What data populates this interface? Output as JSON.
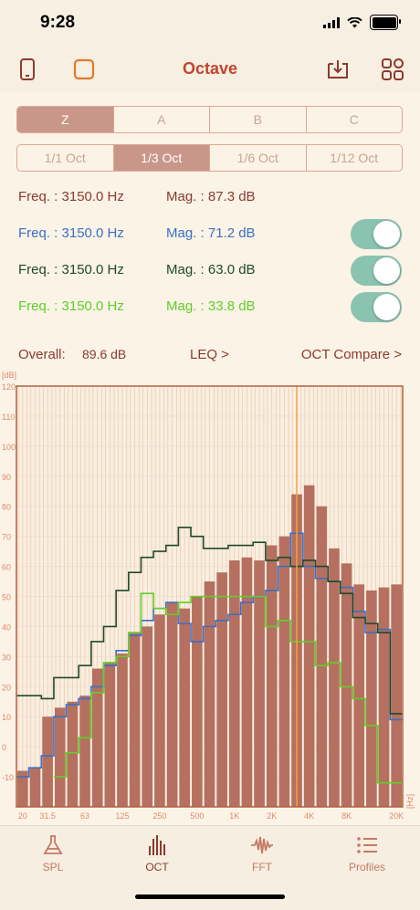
{
  "status": {
    "time": "9:28"
  },
  "nav": {
    "title": "Octave"
  },
  "weighting": {
    "options": [
      "Z",
      "A",
      "B",
      "C"
    ],
    "selected": 0
  },
  "bands": {
    "options": [
      "1/1 Oct",
      "1/3 Oct",
      "1/6 Oct",
      "1/12 Oct"
    ],
    "selected": 1
  },
  "readouts": [
    {
      "freq": "Freq. : 3150.0 Hz",
      "mag": "Mag. : 87.3 dB",
      "color": "#8b3a2f",
      "toggle": false
    },
    {
      "freq": "Freq. : 3150.0 Hz",
      "mag": "Mag. : 71.2 dB",
      "color": "#3d6fc4",
      "toggle": true
    },
    {
      "freq": "Freq. : 3150.0 Hz",
      "mag": "Mag. : 63.0 dB",
      "color": "#1f4a2a",
      "toggle": true
    },
    {
      "freq": "Freq. : 3150.0 Hz",
      "mag": "Mag. : 33.8 dB",
      "color": "#5fcf2a",
      "toggle": true
    }
  ],
  "overall": {
    "label": "Overall:",
    "value": "89.6 dB",
    "leq": "LEQ >",
    "compare": "OCT Compare >"
  },
  "chart_data": {
    "type": "bar",
    "ylabel": "[dB]",
    "xunit": "[Hz]",
    "ylim": [
      -20,
      120
    ],
    "yticks": [
      120,
      110,
      100,
      90,
      80,
      70,
      60,
      50,
      40,
      30,
      20,
      10,
      0,
      -10
    ],
    "xtick_labels": [
      "20",
      "31.5",
      "63",
      "125",
      "250",
      "500",
      "1K",
      "2K",
      "4K",
      "8K",
      "20K"
    ],
    "xtick_band_index": [
      0,
      2,
      5,
      8,
      11,
      14,
      17,
      20,
      23,
      26,
      30
    ],
    "bands_hz": [
      "20",
      "25",
      "31.5",
      "40",
      "50",
      "63",
      "80",
      "100",
      "125",
      "160",
      "200",
      "250",
      "315",
      "400",
      "500",
      "630",
      "800",
      "1K",
      "1.25K",
      "1.6K",
      "2K",
      "2.5K",
      "3.15K",
      "4K",
      "5K",
      "6.3K",
      "8K",
      "10K",
      "12.5K",
      "16K",
      "20K"
    ],
    "cursor_band_index": 22,
    "series": [
      {
        "values": [
          -8,
          -7,
          10,
          13,
          15,
          17,
          26,
          28,
          31,
          38,
          40,
          44,
          48,
          46,
          50,
          55,
          58,
          62,
          63,
          62,
          67,
          70,
          84,
          87,
          80,
          66,
          61,
          54,
          52,
          53,
          54
        ],
        "color": "#b5705f"
      },
      {
        "values": [
          -10,
          -7,
          -3,
          10,
          14,
          16,
          20,
          27,
          32,
          37,
          42,
          46,
          48,
          41,
          35,
          40,
          42,
          44,
          48,
          50,
          52,
          60,
          71,
          60,
          56,
          55,
          53,
          45,
          38,
          39,
          9
        ],
        "color": "#3d6fc4"
      },
      {
        "values": [
          17,
          17,
          16,
          23,
          23,
          27,
          35,
          40,
          52,
          58,
          63,
          65,
          67,
          73,
          70,
          66,
          66,
          67,
          67,
          68,
          62,
          63,
          60,
          62,
          60,
          55,
          51,
          43,
          41,
          38,
          11
        ],
        "color": "#1f4a2a"
      },
      {
        "values": [
          -999,
          -999,
          -999,
          -10,
          -2,
          3,
          18,
          28,
          30,
          38,
          51,
          46,
          44,
          48,
          50,
          50,
          50,
          50,
          50,
          50,
          40,
          42,
          35,
          35,
          27,
          28,
          20,
          16,
          7,
          -12,
          -12
        ],
        "color": "#5fcf2a"
      }
    ]
  },
  "tabs": [
    {
      "label": "SPL",
      "icon": "flask-icon"
    },
    {
      "label": "OCT",
      "icon": "bars-icon"
    },
    {
      "label": "FFT",
      "icon": "waveform-icon"
    },
    {
      "label": "Profiles",
      "icon": "list-icon"
    }
  ]
}
